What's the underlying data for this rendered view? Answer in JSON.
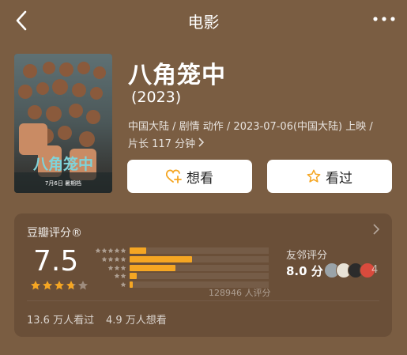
{
  "nav": {
    "title": "电影"
  },
  "movie": {
    "title": "八角笼中",
    "year": "(2023)",
    "meta_line1": "中国大陆 / 剧情 动作 / 2023-07-06(中国大陆) 上映 /",
    "meta_line2": "片长 117 分钟",
    "poster_title": "八角笼中",
    "poster_date": "7月6日 暑期档"
  },
  "buttons": {
    "want": "想看",
    "seen": "看过"
  },
  "rating": {
    "title": "豆瓣评分®",
    "score": "7.5",
    "stars": 3.75,
    "distribution": [
      0.12,
      0.45,
      0.33,
      0.05,
      0.02
    ],
    "count_text": "128946 人评分",
    "friend_label": "友邻评分",
    "friend_score": "8.0 分",
    "friend_count": "4",
    "watched": "13.6 万人看过",
    "wishing": "4.9 万人想看"
  },
  "colors": {
    "background": "#7a5d42",
    "card": "#6a4f38",
    "accent": "#f5a623"
  }
}
